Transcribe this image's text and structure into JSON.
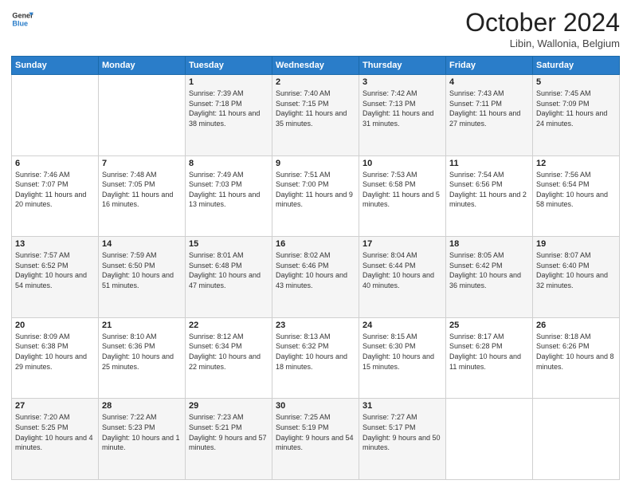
{
  "header": {
    "logo_line1": "General",
    "logo_line2": "Blue",
    "month_title": "October 2024",
    "location": "Libin, Wallonia, Belgium"
  },
  "days_of_week": [
    "Sunday",
    "Monday",
    "Tuesday",
    "Wednesday",
    "Thursday",
    "Friday",
    "Saturday"
  ],
  "weeks": [
    [
      {
        "num": "",
        "detail": ""
      },
      {
        "num": "",
        "detail": ""
      },
      {
        "num": "1",
        "detail": "Sunrise: 7:39 AM\nSunset: 7:18 PM\nDaylight: 11 hours and 38 minutes."
      },
      {
        "num": "2",
        "detail": "Sunrise: 7:40 AM\nSunset: 7:15 PM\nDaylight: 11 hours and 35 minutes."
      },
      {
        "num": "3",
        "detail": "Sunrise: 7:42 AM\nSunset: 7:13 PM\nDaylight: 11 hours and 31 minutes."
      },
      {
        "num": "4",
        "detail": "Sunrise: 7:43 AM\nSunset: 7:11 PM\nDaylight: 11 hours and 27 minutes."
      },
      {
        "num": "5",
        "detail": "Sunrise: 7:45 AM\nSunset: 7:09 PM\nDaylight: 11 hours and 24 minutes."
      }
    ],
    [
      {
        "num": "6",
        "detail": "Sunrise: 7:46 AM\nSunset: 7:07 PM\nDaylight: 11 hours and 20 minutes."
      },
      {
        "num": "7",
        "detail": "Sunrise: 7:48 AM\nSunset: 7:05 PM\nDaylight: 11 hours and 16 minutes."
      },
      {
        "num": "8",
        "detail": "Sunrise: 7:49 AM\nSunset: 7:03 PM\nDaylight: 11 hours and 13 minutes."
      },
      {
        "num": "9",
        "detail": "Sunrise: 7:51 AM\nSunset: 7:00 PM\nDaylight: 11 hours and 9 minutes."
      },
      {
        "num": "10",
        "detail": "Sunrise: 7:53 AM\nSunset: 6:58 PM\nDaylight: 11 hours and 5 minutes."
      },
      {
        "num": "11",
        "detail": "Sunrise: 7:54 AM\nSunset: 6:56 PM\nDaylight: 11 hours and 2 minutes."
      },
      {
        "num": "12",
        "detail": "Sunrise: 7:56 AM\nSunset: 6:54 PM\nDaylight: 10 hours and 58 minutes."
      }
    ],
    [
      {
        "num": "13",
        "detail": "Sunrise: 7:57 AM\nSunset: 6:52 PM\nDaylight: 10 hours and 54 minutes."
      },
      {
        "num": "14",
        "detail": "Sunrise: 7:59 AM\nSunset: 6:50 PM\nDaylight: 10 hours and 51 minutes."
      },
      {
        "num": "15",
        "detail": "Sunrise: 8:01 AM\nSunset: 6:48 PM\nDaylight: 10 hours and 47 minutes."
      },
      {
        "num": "16",
        "detail": "Sunrise: 8:02 AM\nSunset: 6:46 PM\nDaylight: 10 hours and 43 minutes."
      },
      {
        "num": "17",
        "detail": "Sunrise: 8:04 AM\nSunset: 6:44 PM\nDaylight: 10 hours and 40 minutes."
      },
      {
        "num": "18",
        "detail": "Sunrise: 8:05 AM\nSunset: 6:42 PM\nDaylight: 10 hours and 36 minutes."
      },
      {
        "num": "19",
        "detail": "Sunrise: 8:07 AM\nSunset: 6:40 PM\nDaylight: 10 hours and 32 minutes."
      }
    ],
    [
      {
        "num": "20",
        "detail": "Sunrise: 8:09 AM\nSunset: 6:38 PM\nDaylight: 10 hours and 29 minutes."
      },
      {
        "num": "21",
        "detail": "Sunrise: 8:10 AM\nSunset: 6:36 PM\nDaylight: 10 hours and 25 minutes."
      },
      {
        "num": "22",
        "detail": "Sunrise: 8:12 AM\nSunset: 6:34 PM\nDaylight: 10 hours and 22 minutes."
      },
      {
        "num": "23",
        "detail": "Sunrise: 8:13 AM\nSunset: 6:32 PM\nDaylight: 10 hours and 18 minutes."
      },
      {
        "num": "24",
        "detail": "Sunrise: 8:15 AM\nSunset: 6:30 PM\nDaylight: 10 hours and 15 minutes."
      },
      {
        "num": "25",
        "detail": "Sunrise: 8:17 AM\nSunset: 6:28 PM\nDaylight: 10 hours and 11 minutes."
      },
      {
        "num": "26",
        "detail": "Sunrise: 8:18 AM\nSunset: 6:26 PM\nDaylight: 10 hours and 8 minutes."
      }
    ],
    [
      {
        "num": "27",
        "detail": "Sunrise: 7:20 AM\nSunset: 5:25 PM\nDaylight: 10 hours and 4 minutes."
      },
      {
        "num": "28",
        "detail": "Sunrise: 7:22 AM\nSunset: 5:23 PM\nDaylight: 10 hours and 1 minute."
      },
      {
        "num": "29",
        "detail": "Sunrise: 7:23 AM\nSunset: 5:21 PM\nDaylight: 9 hours and 57 minutes."
      },
      {
        "num": "30",
        "detail": "Sunrise: 7:25 AM\nSunset: 5:19 PM\nDaylight: 9 hours and 54 minutes."
      },
      {
        "num": "31",
        "detail": "Sunrise: 7:27 AM\nSunset: 5:17 PM\nDaylight: 9 hours and 50 minutes."
      },
      {
        "num": "",
        "detail": ""
      },
      {
        "num": "",
        "detail": ""
      }
    ]
  ]
}
